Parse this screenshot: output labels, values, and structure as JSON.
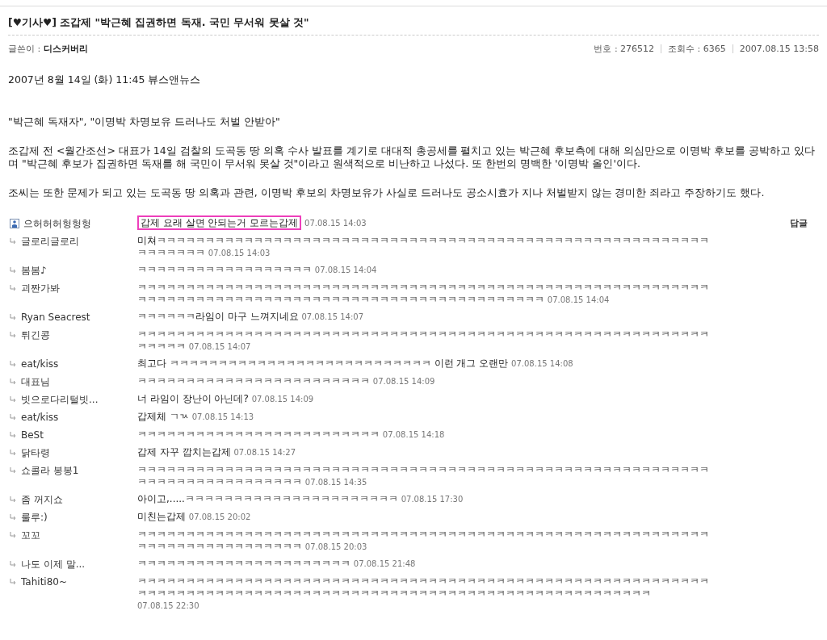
{
  "article": {
    "title": "[♥기사♥] 조갑제 \"박근혜 집권하면 독재. 국민 무서워 못살 것\"",
    "author_label": "글쓴이 :",
    "author": "디스커버리",
    "meta": [
      {
        "label": "번호 :",
        "value": "276512"
      },
      {
        "label": "조회수 :",
        "value": "6365"
      },
      {
        "value": "2007.08.15 13:58"
      }
    ]
  },
  "body": [
    "2007년 8월 14일 (화) 11:45   뷰스앤뉴스",
    "\"박근혜 독재자\", \"이명박 차명보유 드러나도 처벌 안받아\"",
    "조갑제 전 <월간조선> 대표가 14일 검찰의 도곡동 땅 의혹 수사 발표를 계기로 대대적 총공세를 펼치고 있는 박근혜 후보측에 대해 의심만으로 이명박 후보를 공박하고 있다며 \"박근혜 후보가 집권하면 독재를 해 국민이 무서워 못살 것\"이라고 원색적으로 비난하고 나섰다. 또 한번의 명백한 '이명박 올인'이다.",
    "조씨는 또한 문제가 되고 있는 도곡동 땅 의혹과 관련, 이명박 후보의 차명보유가 사실로 드러나도 공소시효가 지나 처벌받지 않는 경미한 죄라고 주장하기도 했다."
  ],
  "comments": [
    {
      "kind": "original",
      "author": "으허허허헝헝헝",
      "text": "갑제 요래 살면 안되는거 모르는갑제",
      "time": "07.08.15 14:03",
      "highlighted": true,
      "reply_link": "답글"
    },
    {
      "kind": "reply",
      "author": "글로리글로리",
      "text": "미쳐ㅋㅋㅋㅋㅋㅋㅋㅋㅋㅋㅋㅋㅋㅋㅋㅋㅋㅋㅋㅋㅋㅋㅋㅋㅋㅋㅋㅋㅋㅋㅋㅋㅋㅋㅋㅋㅋㅋㅋㅋㅋㅋㅋㅋㅋㅋㅋㅋㅋㅋㅋㅋㅋㅋㅋㅋㅋㅋㅋㅋㅋㅋㅋㅋ",
      "time": "07.08.15 14:03",
      "highlighted": false
    },
    {
      "kind": "reply",
      "author": "봄봄♪",
      "text": "ㅋㅋㅋㅋㅋㅋㅋㅋㅋㅋㅋㅋㅋㅋㅋㅋㅋㅋ",
      "time": "07.08.15 14:04",
      "highlighted": false
    },
    {
      "kind": "reply",
      "author": "괴짠가봐",
      "text": "ㅋㅋㅋㅋㅋㅋㅋㅋㅋㅋㅋㅋㅋㅋㅋㅋㅋㅋㅋㅋㅋㅋㅋㅋㅋㅋㅋㅋㅋㅋㅋㅋㅋㅋㅋㅋㅋㅋㅋㅋㅋㅋㅋㅋㅋㅋㅋㅋㅋㅋㅋㅋㅋㅋㅋㅋㅋㅋㅋㅋㅋㅋㅋㅋㅋㅋㅋㅋㅋㅋㅋㅋㅋㅋㅋㅋㅋㅋㅋㅋㅋㅋㅋㅋㅋㅋㅋㅋㅋㅋㅋㅋㅋㅋㅋㅋㅋㅋㅋㅋㅋ",
      "time": "07.08.15 14:04",
      "highlighted": false
    },
    {
      "kind": "reply",
      "author": "Ryan Seacrest",
      "text": "ㅋㅋㅋㅋㅋㅋ라임이 마구 느껴지네요",
      "time": "07.08.15 14:07",
      "highlighted": false
    },
    {
      "kind": "reply",
      "author": "튀긴콩",
      "text": "ㅋㅋㅋㅋㅋㅋㅋㅋㅋㅋㅋㅋㅋㅋㅋㅋㅋㅋㅋㅋㅋㅋㅋㅋㅋㅋㅋㅋㅋㅋㅋㅋㅋㅋㅋㅋㅋㅋㅋㅋㅋㅋㅋㅋㅋㅋㅋㅋㅋㅋㅋㅋㅋㅋㅋㅋㅋㅋㅋㅋㅋㅋㅋㅋ",
      "time": "07.08.15 14:07",
      "highlighted": false
    },
    {
      "kind": "reply",
      "author": "eat/kiss",
      "text": "최고다 ㅋㅋㅋㅋㅋㅋㅋㅋㅋㅋㅋㅋㅋㅋㅋㅋㅋㅋㅋㅋㅋㅋㅋㅋㅋㅋㅋ 이런 개그 오랜만",
      "time": "07.08.15 14:08",
      "highlighted": false
    },
    {
      "kind": "reply",
      "author": "대표님",
      "text": "ㅋㅋㅋㅋㅋㅋㅋㅋㅋㅋㅋㅋㅋㅋㅋㅋㅋㅋㅋㅋㅋㅋㅋㅋ",
      "time": "07.08.15 14:09",
      "highlighted": false
    },
    {
      "kind": "reply",
      "author": "빗으로다리털빗...",
      "text": "너 라임이 장난이 아닌데?",
      "time": "07.08.15 14:09",
      "highlighted": false
    },
    {
      "kind": "reply",
      "author": "eat/kiss",
      "text": "갑제체 ㄱㄳ",
      "time": "07.08.15 14:13",
      "highlighted": false
    },
    {
      "kind": "reply",
      "author": "BeSt",
      "text": "ㅋㅋㅋㅋㅋㅋㅋㅋㅋㅋㅋㅋㅋㅋㅋㅋㅋㅋㅋㅋㅋㅋㅋㅋㅋ",
      "time": "07.08.15 14:18",
      "highlighted": false
    },
    {
      "kind": "reply",
      "author": "닭타령",
      "text": "갑제 자꾸 깝치는갑제",
      "time": "07.08.15 14:27",
      "highlighted": false
    },
    {
      "kind": "reply",
      "author": "쇼콜라 봉봉1",
      "text": "ㅋㅋㅋㅋㅋㅋㅋㅋㅋㅋㅋㅋㅋㅋㅋㅋㅋㅋㅋㅋㅋㅋㅋㅋㅋㅋㅋㅋㅋㅋㅋㅋㅋㅋㅋㅋㅋㅋㅋㅋㅋㅋㅋㅋㅋㅋㅋㅋㅋㅋㅋㅋㅋㅋㅋㅋㅋㅋㅋㅋㅋㅋㅋㅋㅋㅋㅋㅋㅋㅋㅋㅋㅋㅋㅋㅋ",
      "time": "07.08.15 14:35",
      "highlighted": false
    },
    {
      "kind": "reply",
      "author": "좀 꺼지쇼",
      "text": "아이고,.....ㅋㅋㅋㅋㅋㅋㅋㅋㅋㅋㅋㅋㅋㅋㅋㅋㅋㅋㅋㅋㅋㅋ",
      "time": "07.08.15 17:30",
      "highlighted": false
    },
    {
      "kind": "reply",
      "author": "룰루:)",
      "text": "미친는갑제",
      "time": "07.08.15 20:02",
      "highlighted": false
    },
    {
      "kind": "reply",
      "author": "꼬꼬",
      "text": "ㅋㅋㅋㅋㅋㅋㅋㅋㅋㅋㅋㅋㅋㅋㅋㅋㅋㅋㅋㅋㅋㅋㅋㅋㅋㅋㅋㅋㅋㅋㅋㅋㅋㅋㅋㅋㅋㅋㅋㅋㅋㅋㅋㅋㅋㅋㅋㅋㅋㅋㅋㅋㅋㅋㅋㅋㅋㅋㅋㅋㅋㅋㅋㅋㅋㅋㅋㅋㅋㅋㅋㅋㅋㅋㅋㅋ",
      "time": "07.08.15 20:03",
      "highlighted": false
    },
    {
      "kind": "reply",
      "author": "나도 이제 말...",
      "text": "ㅋㅋㅋㅋㅋㅋㅋㅋㅋㅋㅋㅋㅋㅋㅋㅋㅋㅋㅋㅋㅋㅋ",
      "time": "07.08.15 21:48",
      "highlighted": false
    },
    {
      "kind": "reply",
      "author": "Tahiti80~",
      "text": "ㅋㅋㅋㅋㅋㅋㅋㅋㅋㅋㅋㅋㅋㅋㅋㅋㅋㅋㅋㅋㅋㅋㅋㅋㅋㅋㅋㅋㅋㅋㅋㅋㅋㅋㅋㅋㅋㅋㅋㅋㅋㅋㅋㅋㅋㅋㅋㅋㅋㅋㅋㅋㅋㅋㅋㅋㅋㅋㅋㅋㅋㅋㅋㅋㅋㅋㅋㅋㅋㅋㅋㅋㅋㅋㅋㅋㅋㅋㅋㅋㅋㅋㅋㅋㅋㅋㅋㅋㅋㅋㅋㅋㅋㅋㅋㅋㅋㅋㅋㅋㅋㅋㅋㅋㅋㅋㅋㅋㅋㅋㅋㅋ",
      "time": "07.08.15 22:30",
      "highlighted": false
    }
  ]
}
